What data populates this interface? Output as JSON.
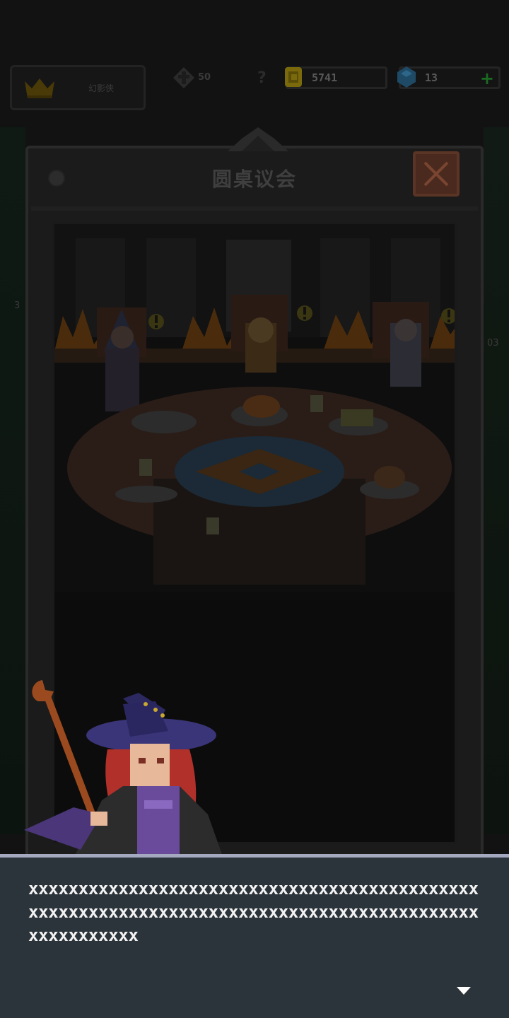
{
  "header": {
    "player_name": "幻影侠",
    "power_value": "50",
    "help_label": "?",
    "gold": "5741",
    "gems": "13",
    "add_label": "+"
  },
  "modal": {
    "title": "圆桌议会"
  },
  "dialog": {
    "text": "xxxxxxxxxxxxxxxxxxxxxxxxxxxxxxxxxxxxxxxxxxxxxxxxxxxxxxxxxxxxxxxxxxxxxxxxxxxxxxxxxxxxxxxxxxxxxxxxxxxxx"
  },
  "icons": {
    "crown": "crown-icon",
    "power": "power-icon",
    "gold": "gold-coin-icon",
    "gem": "gem-icon",
    "close": "close-icon",
    "next": "chevron-down-icon",
    "alert": "exclamation-icon"
  },
  "colors": {
    "dialog_bg": "#2c343b",
    "dialog_border": "#a4a9c0",
    "close_button": "#4a2a1e",
    "gold": "#8a7a10",
    "gem": "#1e5a7a",
    "plus": "#1a6b22"
  }
}
